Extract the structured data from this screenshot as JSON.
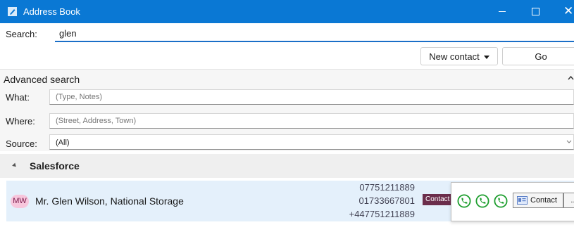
{
  "window": {
    "title": "Address Book",
    "close_glyph": "✕"
  },
  "search": {
    "label": "Search:",
    "value": "glen"
  },
  "toolbar": {
    "new_contact_label": "New contact",
    "go_label": "Go"
  },
  "advanced": {
    "title": "Advanced search",
    "what": {
      "label": "What:",
      "placeholder": "(Type, Notes)"
    },
    "where": {
      "label": "Where:",
      "placeholder": "(Street, Address, Town)"
    },
    "source": {
      "label": "Source:",
      "value": "(All)"
    }
  },
  "results": {
    "group_name": "Salesforce",
    "contacts": [
      {
        "initials": "MW",
        "name": "Mr. Glen Wilson, National Storage",
        "phones": [
          "07751211889",
          "01733667801",
          "+447751211889"
        ],
        "type_badge": "Contact",
        "actions": {
          "contact_label": "Contact",
          "more_label": "..."
        }
      }
    ]
  },
  "colors": {
    "accent": "#0a78d4",
    "row_highlight": "#e4f0fb",
    "call_green": "#1d9e2e",
    "badge": "#6b2d4b",
    "avatar": "#f7c6dc"
  }
}
